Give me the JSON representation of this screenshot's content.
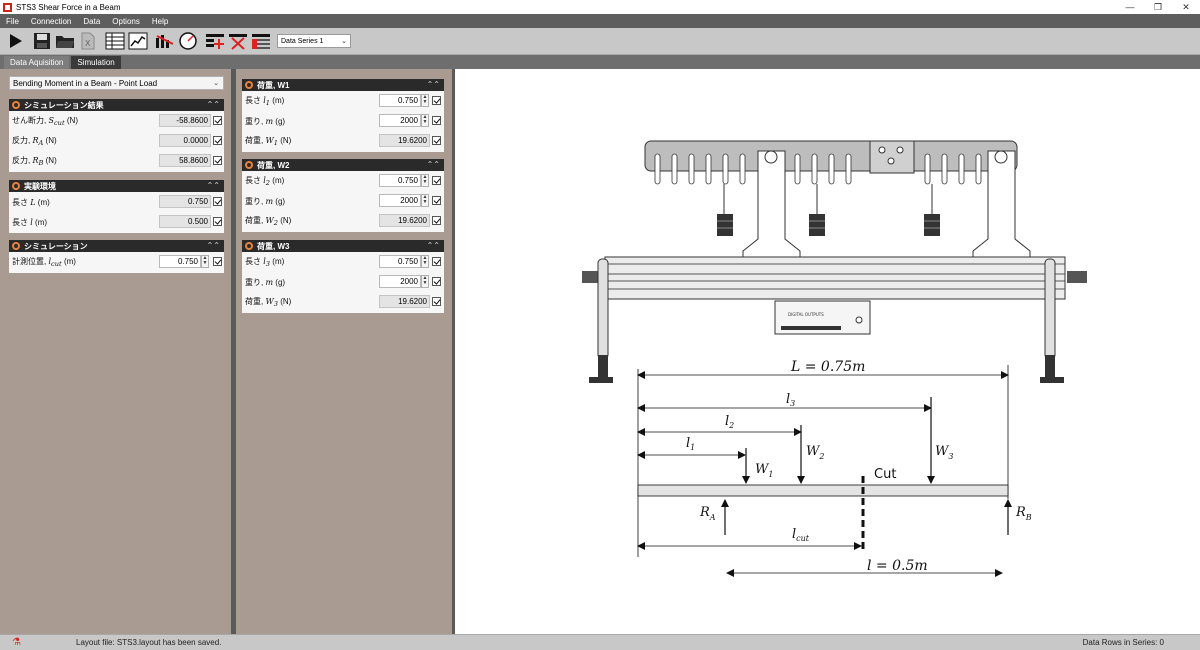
{
  "window": {
    "title": "STS3 Shear Force in a Beam"
  },
  "menu": [
    "File",
    "Connection",
    "Data",
    "Options",
    "Help"
  ],
  "toolbar": {
    "series": "Data Series 1"
  },
  "tabs": [
    "Data Aquisition",
    "Simulation"
  ],
  "simulation": {
    "preset": "Bending Moment in a Beam - Point Load",
    "results": {
      "title": "シミュレーション結果",
      "rows": [
        {
          "label": "せん断力,",
          "sym": "S",
          "sub": "cut",
          "unit": "(N)",
          "value": "-58.8600"
        },
        {
          "label": "反力,",
          "sym": "R",
          "sub": "A",
          "unit": "(N)",
          "value": "0.0000"
        },
        {
          "label": "反力,",
          "sym": "R",
          "sub": "B",
          "unit": "(N)",
          "value": "58.8600"
        }
      ]
    },
    "env": {
      "title": "実験環境",
      "rows": [
        {
          "label": "長さ",
          "sym": "L",
          "sub": "",
          "unit": "(m)",
          "value": "0.750"
        },
        {
          "label": "長さ",
          "sym": "l",
          "sub": "",
          "unit": "(m)",
          "value": "0.500"
        }
      ]
    },
    "sim": {
      "title": "シミュレーション",
      "rows": [
        {
          "label": "計測位置,",
          "sym": "l",
          "sub": "cut",
          "unit": "(m)",
          "value": "0.750"
        }
      ]
    }
  },
  "loads": [
    {
      "title": "荷重, W1",
      "rows": [
        {
          "label": "長さ",
          "sym": "l",
          "sub": "1",
          "unit": "(m)",
          "value": "0.750"
        },
        {
          "label": "重り,",
          "sym": "m",
          "sub": "",
          "unit": "(g)",
          "value": "2000"
        },
        {
          "label": "荷重,",
          "sym": "W",
          "sub": "1",
          "unit": "(N)",
          "value": "19.6200"
        }
      ]
    },
    {
      "title": "荷重, W2",
      "rows": [
        {
          "label": "長さ",
          "sym": "l",
          "sub": "2",
          "unit": "(m)",
          "value": "0.750"
        },
        {
          "label": "重り,",
          "sym": "m",
          "sub": "",
          "unit": "(g)",
          "value": "2000"
        },
        {
          "label": "荷重,",
          "sym": "W",
          "sub": "2",
          "unit": "(N)",
          "value": "19.6200"
        }
      ]
    },
    {
      "title": "荷重, W3",
      "rows": [
        {
          "label": "長さ",
          "sym": "l",
          "sub": "3",
          "unit": "(m)",
          "value": "0.750"
        },
        {
          "label": "重り,",
          "sym": "m",
          "sub": "",
          "unit": "(g)",
          "value": "2000"
        },
        {
          "label": "荷重,",
          "sym": "W",
          "sub": "3",
          "unit": "(N)",
          "value": "19.6200"
        }
      ]
    }
  ],
  "diagram": {
    "L_label": "L = 0.75m",
    "l_label": "l = 0.5m",
    "cut_label": "Cut",
    "device_label": "DIGITAL OUTPUTS"
  },
  "status": {
    "message": "Layout file: STS3.layout has been saved.",
    "rows": "Data Rows in Series: 0"
  }
}
